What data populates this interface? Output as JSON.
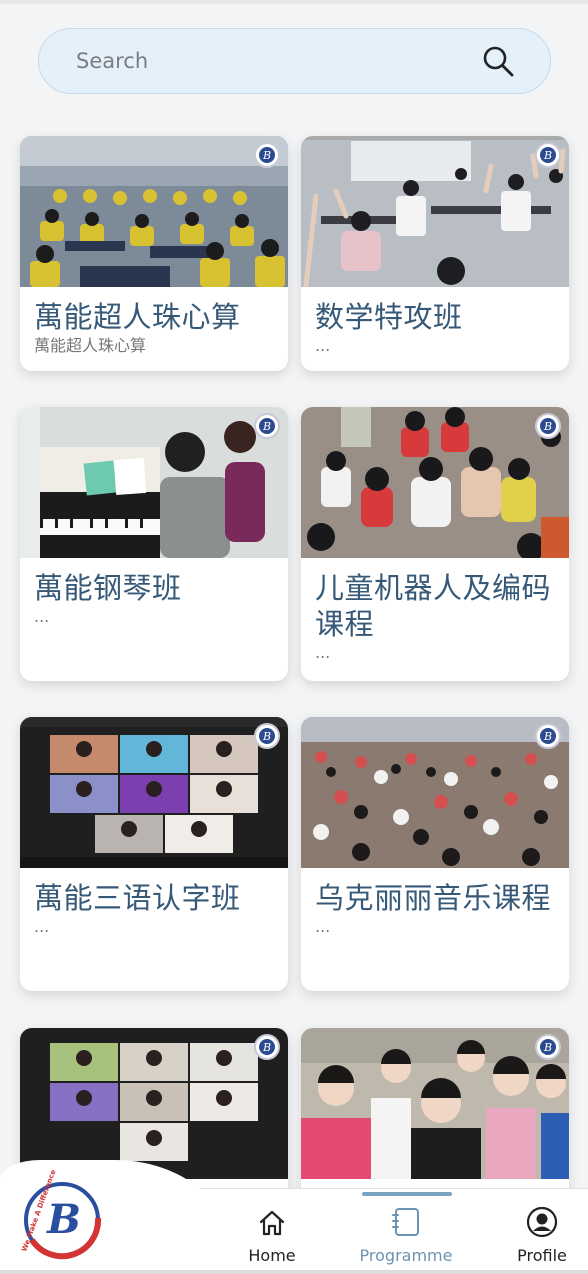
{
  "search": {
    "placeholder": "Search"
  },
  "cards": [
    {
      "title": "萬能超人珠心算",
      "subtitle": "萬能超人珠心算"
    },
    {
      "title": "数学特攻班",
      "subtitle": "..."
    },
    {
      "title": "萬能钢琴班",
      "subtitle": "..."
    },
    {
      "title": "儿童机器人及编码课程",
      "subtitle": "..."
    },
    {
      "title": "萬能三语认字班",
      "subtitle": "..."
    },
    {
      "title": "乌克丽丽音乐课程",
      "subtitle": "..."
    },
    {
      "title": "",
      "subtitle": ""
    },
    {
      "title": "",
      "subtitle": ""
    }
  ],
  "nav": {
    "home": "Home",
    "programme": "Programme",
    "profile": "Profile"
  },
  "brand": {
    "logo_text": "We Make A Difference"
  },
  "colors": {
    "accent": "#375978",
    "nav_active": "#6d93b3",
    "search_bg": "#e4f0fa"
  }
}
